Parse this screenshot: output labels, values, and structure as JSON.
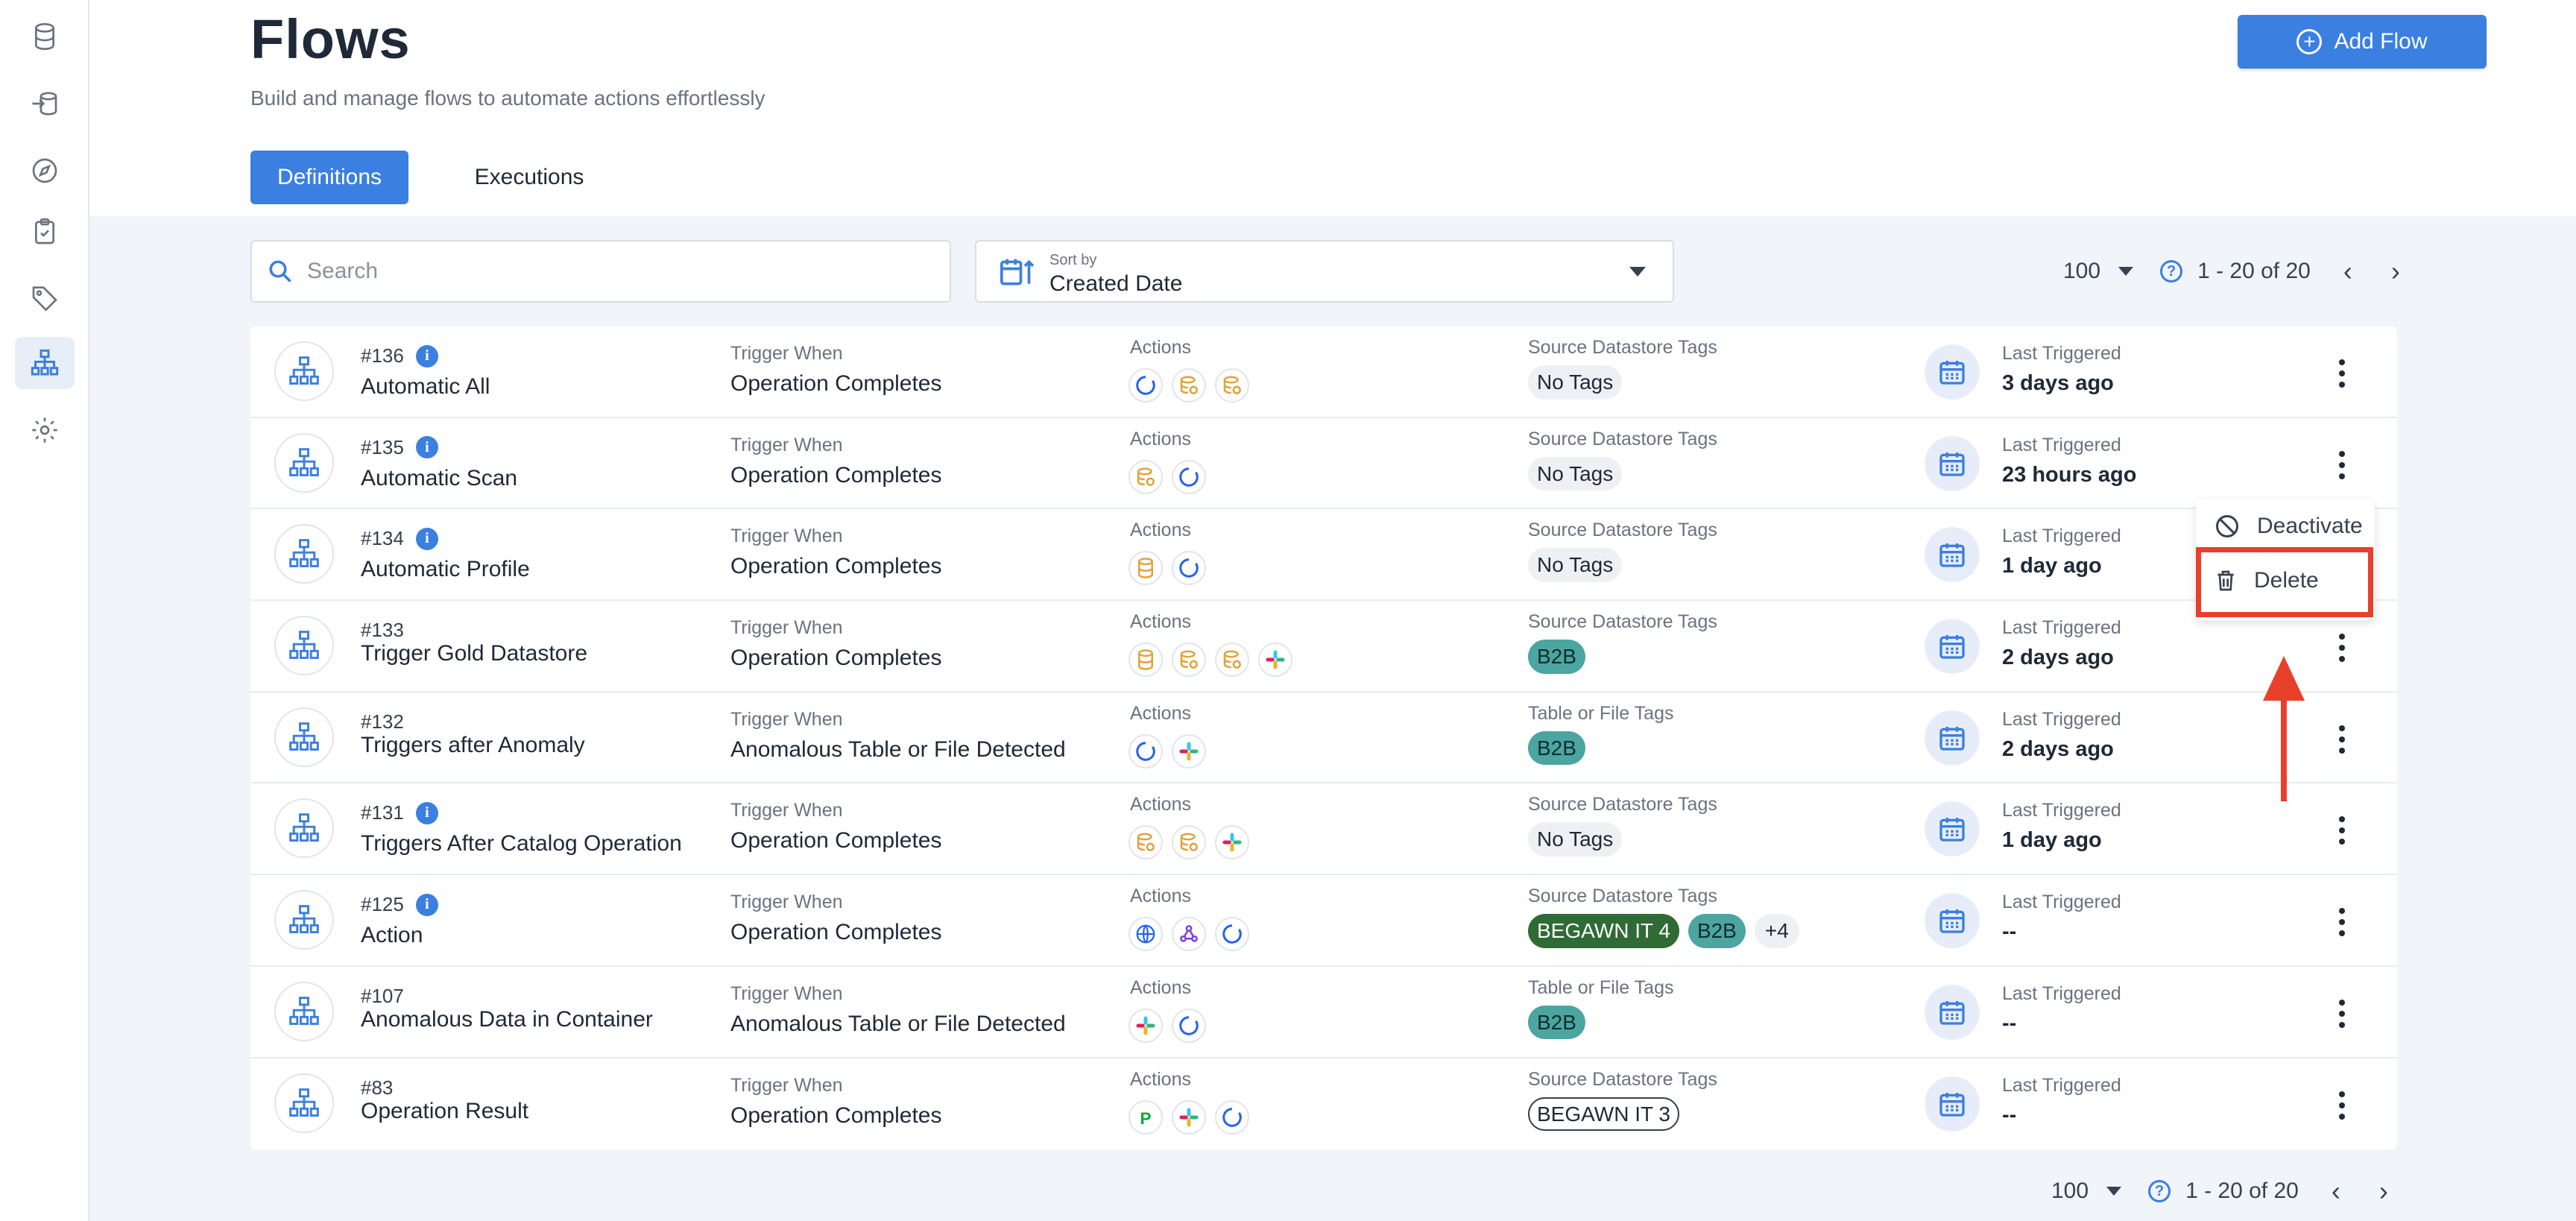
{
  "app": {
    "page_title": "Flows",
    "subtitle": "Build and manage flows to automate actions effortlessly",
    "add_button": "Add Flow",
    "tabs": [
      "Definitions",
      "Executions"
    ],
    "active_tab": "Definitions"
  },
  "sidebar": {
    "items": [
      {
        "icon": "database-icon"
      },
      {
        "icon": "import-icon"
      },
      {
        "icon": "compass-icon"
      },
      {
        "icon": "checklist-icon"
      },
      {
        "icon": "tag-icon"
      },
      {
        "icon": "flows-icon",
        "active": true
      },
      {
        "icon": "settings-icon"
      }
    ]
  },
  "toolbar": {
    "search_placeholder": "Search",
    "sort_label": "Sort by",
    "sort_value": "Created Date",
    "per_page": "100",
    "range": "1 - 20 of 20"
  },
  "columns": {
    "trigger": "Trigger When",
    "actions": "Actions",
    "last_triggered": "Last Triggered"
  },
  "rows": [
    {
      "id": "#136",
      "name": "Automatic All",
      "info": true,
      "trigger": "Operation Completes",
      "actions": [
        "operation",
        "datastore",
        "datastore"
      ],
      "tags_label": "Source Datastore Tags",
      "tags": [
        {
          "text": "No Tags",
          "style": "gray"
        }
      ],
      "last": "3 days ago"
    },
    {
      "id": "#135",
      "name": "Automatic Scan",
      "info": true,
      "trigger": "Operation Completes",
      "actions": [
        "datastore",
        "operation"
      ],
      "tags_label": "Source Datastore Tags",
      "tags": [
        {
          "text": "No Tags",
          "style": "gray"
        }
      ],
      "last": "23 hours ago"
    },
    {
      "id": "#134",
      "name": "Automatic Profile",
      "info": true,
      "trigger": "Operation Completes",
      "actions": [
        "database",
        "operation"
      ],
      "tags_label": "Source Datastore Tags",
      "tags": [
        {
          "text": "No Tags",
          "style": "gray"
        }
      ],
      "last": "1 day ago"
    },
    {
      "id": "#133",
      "name": "Trigger Gold Datastore",
      "info": false,
      "trigger": "Operation Completes",
      "actions": [
        "database",
        "datastore",
        "datastore",
        "slack"
      ],
      "tags_label": "Source Datastore Tags",
      "tags": [
        {
          "text": "B2B",
          "style": "teal"
        }
      ],
      "last": "2 days ago"
    },
    {
      "id": "#132",
      "name": "Triggers after Anomaly",
      "info": false,
      "trigger": "Anomalous Table or File Detected",
      "actions": [
        "operation",
        "slack"
      ],
      "tags_label": "Table or File Tags",
      "tags": [
        {
          "text": "B2B",
          "style": "teal"
        }
      ],
      "last": "2 days ago"
    },
    {
      "id": "#131",
      "name": "Triggers After Catalog Operation",
      "info": true,
      "trigger": "Operation Completes",
      "actions": [
        "datastore",
        "datastore",
        "slack"
      ],
      "tags_label": "Source Datastore Tags",
      "tags": [
        {
          "text": "No Tags",
          "style": "gray"
        }
      ],
      "last": "1 day ago"
    },
    {
      "id": "#125",
      "name": "Action",
      "info": true,
      "trigger": "Operation Completes",
      "actions": [
        "globe",
        "webhook",
        "operation"
      ],
      "tags_label": "Source Datastore Tags",
      "tags": [
        {
          "text": "BEGAWN IT 4",
          "style": "dkgreen"
        },
        {
          "text": "B2B",
          "style": "teal"
        },
        {
          "text": "+4",
          "style": "more"
        }
      ],
      "last": "--"
    },
    {
      "id": "#107",
      "name": "Anomalous Data in Container",
      "info": false,
      "trigger": "Anomalous Table or File Detected",
      "actions": [
        "slack",
        "operation"
      ],
      "tags_label": "Table or File Tags",
      "tags": [
        {
          "text": "B2B",
          "style": "teal"
        }
      ],
      "last": "--"
    },
    {
      "id": "#83",
      "name": "Operation Result",
      "info": false,
      "trigger": "Operation Completes",
      "actions": [
        "pagerduty",
        "slack",
        "operation"
      ],
      "tags_label": "Source Datastore Tags",
      "tags": [
        {
          "text": "BEGAWN IT 3",
          "style": "outline"
        }
      ],
      "last": "--"
    }
  ],
  "context_menu": {
    "items": [
      "Deactivate",
      "Delete"
    ],
    "highlighted": "Delete"
  },
  "colors": {
    "accent": "#3b7fe0",
    "highlight": "#e8402a",
    "tag_teal": "#4ba5a0",
    "tag_dark_green": "#2f6b34",
    "background": "#f1f4f9"
  }
}
